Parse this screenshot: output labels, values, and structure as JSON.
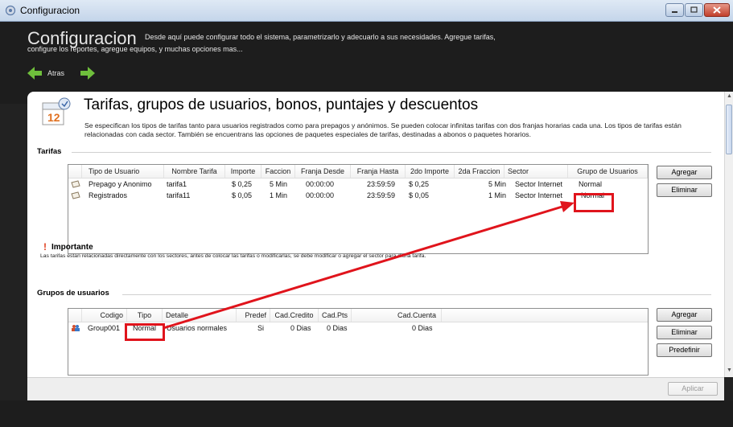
{
  "window": {
    "title": "Configuracion"
  },
  "header": {
    "title": "Configuracion",
    "desc_line1": "Desde aquí puede configurar todo el sistema, parametrizarlo y adecuarlo a sus necesidades. Agregue tarifas,",
    "desc_line2": "configure los reportes, agregue equipos, y muchas opciones mas...",
    "back_label": "Atras"
  },
  "panel": {
    "title": "Tarifas, grupos de usuarios, bonos, puntajes y descuentos",
    "description": "Se especifican los tipos de tarifas tanto para usuarios registrados como para prepagos y anónimos. Se pueden colocar infinitas tarifas con dos franjas horarias cada una. Los tipos de tarifas están relacionadas con cada sector. También se encuentrans las opciones de paquetes especiales de tarifas, destinadas a abonos o paquetes horarios."
  },
  "tarifas": {
    "section_label": "Tarifas",
    "columns": [
      "Tipo de Usuario",
      "Nombre Tarifa",
      "Importe",
      "Faccion",
      "Franja Desde",
      "Franja Hasta",
      "2do Importe",
      "2da Fraccion",
      "Sector",
      "Grupo de Usuarios"
    ],
    "rows": [
      {
        "tipo": "Prepago y Anonimo",
        "nombre": "tarifa1",
        "importe": "$ 0,25",
        "faccion": "5 Min",
        "desde": "00:00:00",
        "hasta": "23:59:59",
        "importe2": "$ 0,25",
        "fraccion2": "5 Min",
        "sector": "Sector Internet",
        "grupo": "Normal"
      },
      {
        "tipo": "Registrados",
        "nombre": "tarifa11",
        "importe": "$ 0,05",
        "faccion": "1 Min",
        "desde": "00:00:00",
        "hasta": "23:59:59",
        "importe2": "$ 0,05",
        "fraccion2": "1 Min",
        "sector": "Sector Internet",
        "grupo": "Normal"
      }
    ],
    "buttons": {
      "agregar": "Agregar",
      "eliminar": "Eliminar"
    }
  },
  "importante": {
    "title": "Importante",
    "text": "Las tarifas estan relacionadas directamente con los sectores, antes de colocar las tarifas o modificarlas, se debe modificar o agregar el sector para dicha tarifa."
  },
  "grupos": {
    "section_label": "Grupos de usuarios",
    "columns": [
      "Codigo",
      "Tipo",
      "Detalle",
      "Predef",
      "Cad.Credito",
      "Cad.Pts",
      "Cad.Cuenta"
    ],
    "rows": [
      {
        "codigo": "Group001",
        "tipo": "Normal",
        "detalle": "Usuarios normales",
        "predef": "Si",
        "cad_credito": "0 Dias",
        "cad_pts": "0 Dias",
        "cad_cuenta": "0 Dias"
      }
    ],
    "buttons": {
      "agregar": "Agregar",
      "eliminar": "Eliminar",
      "predefinir": "Predefinir"
    }
  },
  "footer": {
    "aplicar": "Aplicar"
  },
  "colors": {
    "annotation": "#e0141c",
    "header_bg": "#1d1d1d",
    "nav_arrow": "#6fbf3c"
  },
  "icons": [
    "app-gear-icon",
    "back-arrow-icon",
    "forward-arrow-icon",
    "calendar-icon",
    "warning-icon",
    "ticket-icon",
    "users-group-icon"
  ]
}
